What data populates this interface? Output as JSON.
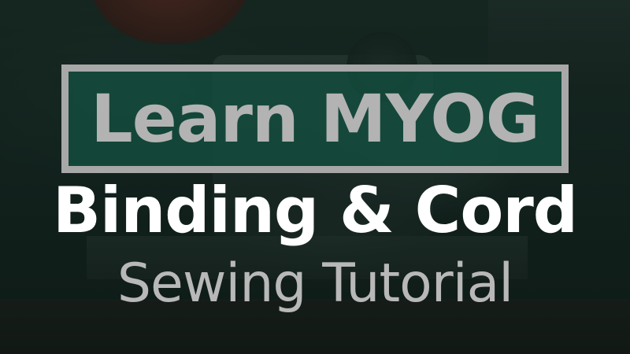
{
  "thumbnail": {
    "title": "Learn MYOG",
    "headline": "Binding & Cord",
    "subtitle": "Sewing Tutorial"
  },
  "colors": {
    "title_box_fill": "#144e3e",
    "title_box_border": "#a8a8a8",
    "title_text": "#b3b3b3",
    "headline_text": "#ffffff",
    "subtitle_text": "#b8b8b8"
  },
  "background": {
    "description_icon": "sewing-machine-photo"
  }
}
